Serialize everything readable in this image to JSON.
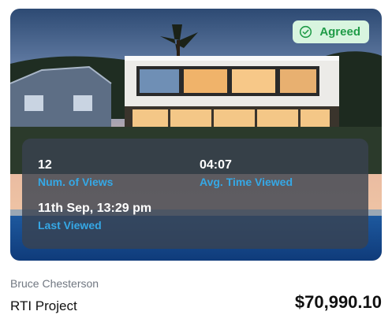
{
  "badge": {
    "label": "Agreed",
    "icon": "check-circle-icon",
    "bg_color": "#d8f5df",
    "text_color": "#1f9b47"
  },
  "stats": {
    "views_value": "12",
    "views_label": "Num. of Views",
    "avg_time_value": "04:07",
    "avg_time_label": "Avg. Time Viewed",
    "last_viewed_value": "11th Sep, 13:29 pm",
    "last_viewed_label": "Last Viewed",
    "label_color": "#35a8e6"
  },
  "listing": {
    "owner": "Bruce Chesterson",
    "project": "RTI Project",
    "price": "$70,990.10"
  }
}
